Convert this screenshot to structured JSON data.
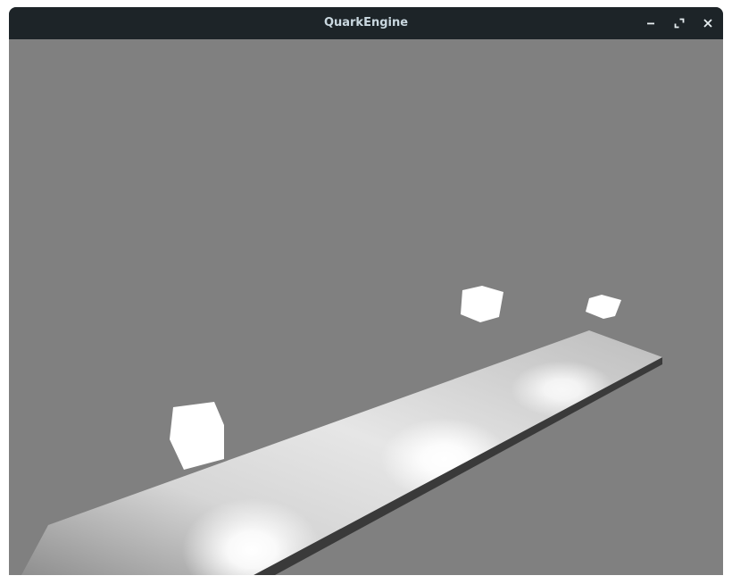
{
  "window": {
    "title": "QuarkEngine",
    "controls": [
      {
        "name": "minimize-button",
        "icon": "minimize-icon"
      },
      {
        "name": "maximize-button",
        "icon": "maximize-icon"
      },
      {
        "name": "close-button",
        "icon": "close-icon"
      }
    ]
  },
  "scene": {
    "background_color": "#808080",
    "objects": [
      {
        "name": "floor-platform",
        "kind": "platform"
      },
      {
        "name": "light-cube-left",
        "kind": "cube"
      },
      {
        "name": "light-cube-middle",
        "kind": "cube"
      },
      {
        "name": "light-cube-right",
        "kind": "cube"
      }
    ]
  }
}
